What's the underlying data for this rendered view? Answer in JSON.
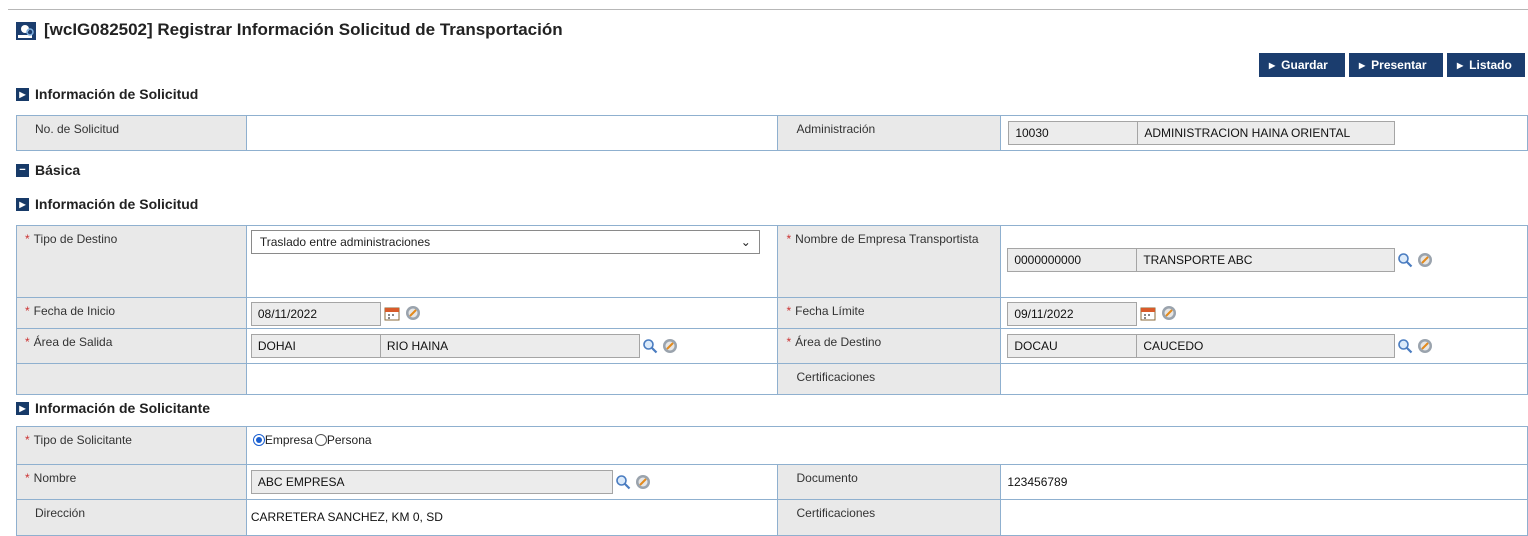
{
  "header": {
    "title": "[wcIG082502] Registrar Información Solicitud de Transportación",
    "buttons": {
      "guardar": "Guardar",
      "presentar": "Presentar",
      "listado": "Listado"
    }
  },
  "sections": {
    "info_solicitud_1": "Información de Solicitud",
    "basica": "Básica",
    "info_solicitud_2": "Información de Solicitud",
    "info_solicitante": "Información de Solicitante"
  },
  "solicitud": {
    "no_label": "No. de Solicitud",
    "no_value": "",
    "admin_label": "Administración",
    "admin_code": "10030",
    "admin_name": "ADMINISTRACION HAINA ORIENTAL"
  },
  "basic": {
    "tipo_destino_label": "Tipo de Destino",
    "tipo_destino_value": "Traslado entre administraciones",
    "empresa_label": "Nombre de Empresa Transportista",
    "empresa_code": "0000000000",
    "empresa_name": "TRANSPORTE ABC",
    "fecha_inicio_label": "Fecha de Inicio",
    "fecha_inicio_value": "08/11/2022",
    "fecha_limite_label": "Fecha Límite",
    "fecha_limite_value": "09/11/2022",
    "area_salida_label": "Área de Salida",
    "area_salida_code": "DOHAI",
    "area_salida_name": "RIO HAINA",
    "area_destino_label": "Área de Destino",
    "area_destino_code": "DOCAU",
    "area_destino_name": "CAUCEDO",
    "certificaciones_label": "Certificaciones"
  },
  "solicitante": {
    "tipo_label": "Tipo de Solicitante",
    "opt_empresa": "Empresa",
    "opt_persona": "Persona",
    "nombre_label": "Nombre",
    "nombre_value": "ABC EMPRESA",
    "documento_label": "Documento",
    "documento_value": "123456789",
    "direccion_label": "Dirección",
    "direccion_value": "CARRETERA SANCHEZ, KM 0, SD",
    "certificaciones_label": "Certificaciones"
  },
  "colors": {
    "button_bg": "#1b3d6e",
    "required": "#cc3333",
    "label_bg": "#e9e9e9",
    "border": "#8fb0cf"
  },
  "icons": [
    "user-search-icon",
    "magnifier-icon",
    "clear-icon",
    "calendar-icon",
    "section-expand-icon",
    "section-collapse-icon"
  ]
}
